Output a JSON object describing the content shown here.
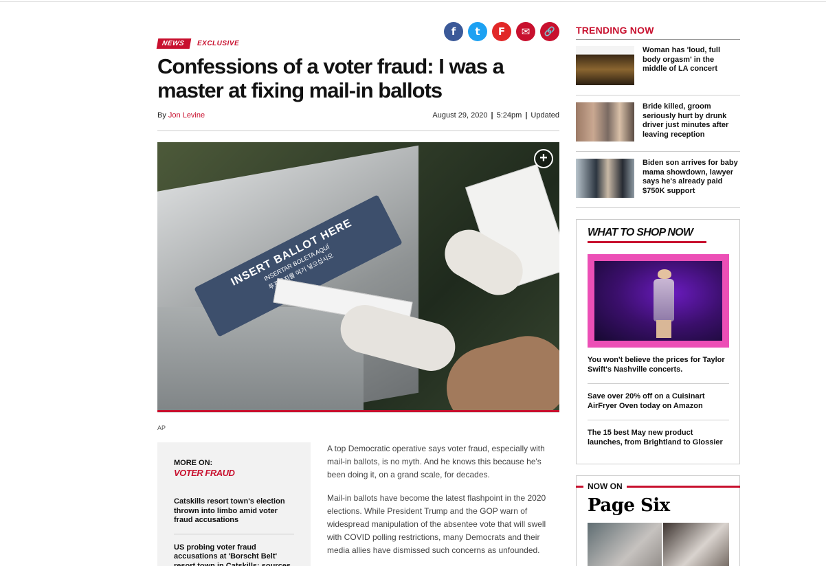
{
  "article": {
    "tag_news": "NEWS",
    "tag_exclusive": "EXCLUSIVE",
    "headline": "Confessions of a voter fraud: I was a master at fixing mail-in ballots",
    "byline_prefix": "By",
    "author": "Jon Levine",
    "date": "August 29, 2020",
    "time": "5:24pm",
    "updated": "Updated",
    "photo": {
      "label_main": "INSERT BALLOT HERE",
      "label_spanish": "INSERTAR BOLETA AQUÍ",
      "label_korean": "투표용지를 여기 넣으십시오",
      "credit": "AP"
    },
    "paragraphs": [
      "A top Democratic operative says voter fraud, especially with mail-in ballots, is no myth. And he knows this because he's been doing it, on a grand scale, for decades.",
      "Mail-in ballots have become the latest flashpoint in the 2020 elections. While President Trump and the GOP warn of widespread manipulation of the absentee vote that will swell with COVID polling restrictions, many Democrats and their media allies have dismissed such concerns as unfounded."
    ]
  },
  "share": {
    "facebook": "f",
    "twitter": "t",
    "flipboard": "F",
    "email": "✉",
    "link": "🔗",
    "colors": {
      "facebook": "#3b5998",
      "twitter": "#1da1f2",
      "flipboard": "#e12828",
      "email": "#c8102e",
      "link": "#c8102e"
    }
  },
  "more_on": {
    "label": "MORE ON:",
    "topic": "VOTER FRAUD",
    "items": [
      "Catskills resort town's election thrown into limbo amid voter fraud accusations",
      "US probing voter fraud accusations at 'Borscht Belt' resort town in Catskills: sources"
    ]
  },
  "trending": {
    "title": "TRENDING NOW",
    "items": [
      {
        "title": "Woman has 'loud, full body orgasm' in the middle of LA concert"
      },
      {
        "title": "Bride killed, groom seriously hurt by drunk driver just minutes after leaving reception"
      },
      {
        "title": "Biden son arrives for baby mama showdown, lawyer says he's already paid $750K support"
      }
    ]
  },
  "shop": {
    "title": "WHAT TO SHOP NOW",
    "items": [
      "You won't believe the prices for Taylor Swift's Nashville concerts.",
      "Save over 20% off on a Cuisinart AirFryer Oven today on Amazon",
      "The 15 best May new product launches, from Brightland to Glossier"
    ]
  },
  "page_six": {
    "label": "NOW ON",
    "brand": "Page Six"
  },
  "colors": {
    "accent": "#c8102e"
  }
}
